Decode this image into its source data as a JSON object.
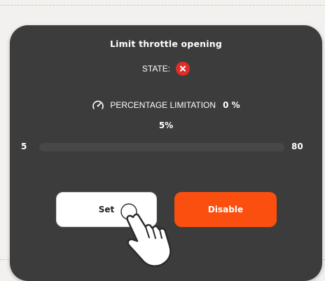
{
  "dialog": {
    "title": "Limit throttle opening",
    "state_label": "STATE:",
    "state_icon": "close-icon",
    "state_color": "#e02d28",
    "limit_label": "PERCENTAGE LIMITATION",
    "limit_icon": "speedometer-icon",
    "limit_value": "0 %",
    "slider": {
      "value_display": "5%",
      "min_label": "5",
      "max_label": "80",
      "value_fraction": 0
    },
    "buttons": {
      "set_label": "Set",
      "disable_label": "Disable",
      "disable_color": "#fb4f0f"
    },
    "cursor_icon": "pointing-hand-icon"
  }
}
